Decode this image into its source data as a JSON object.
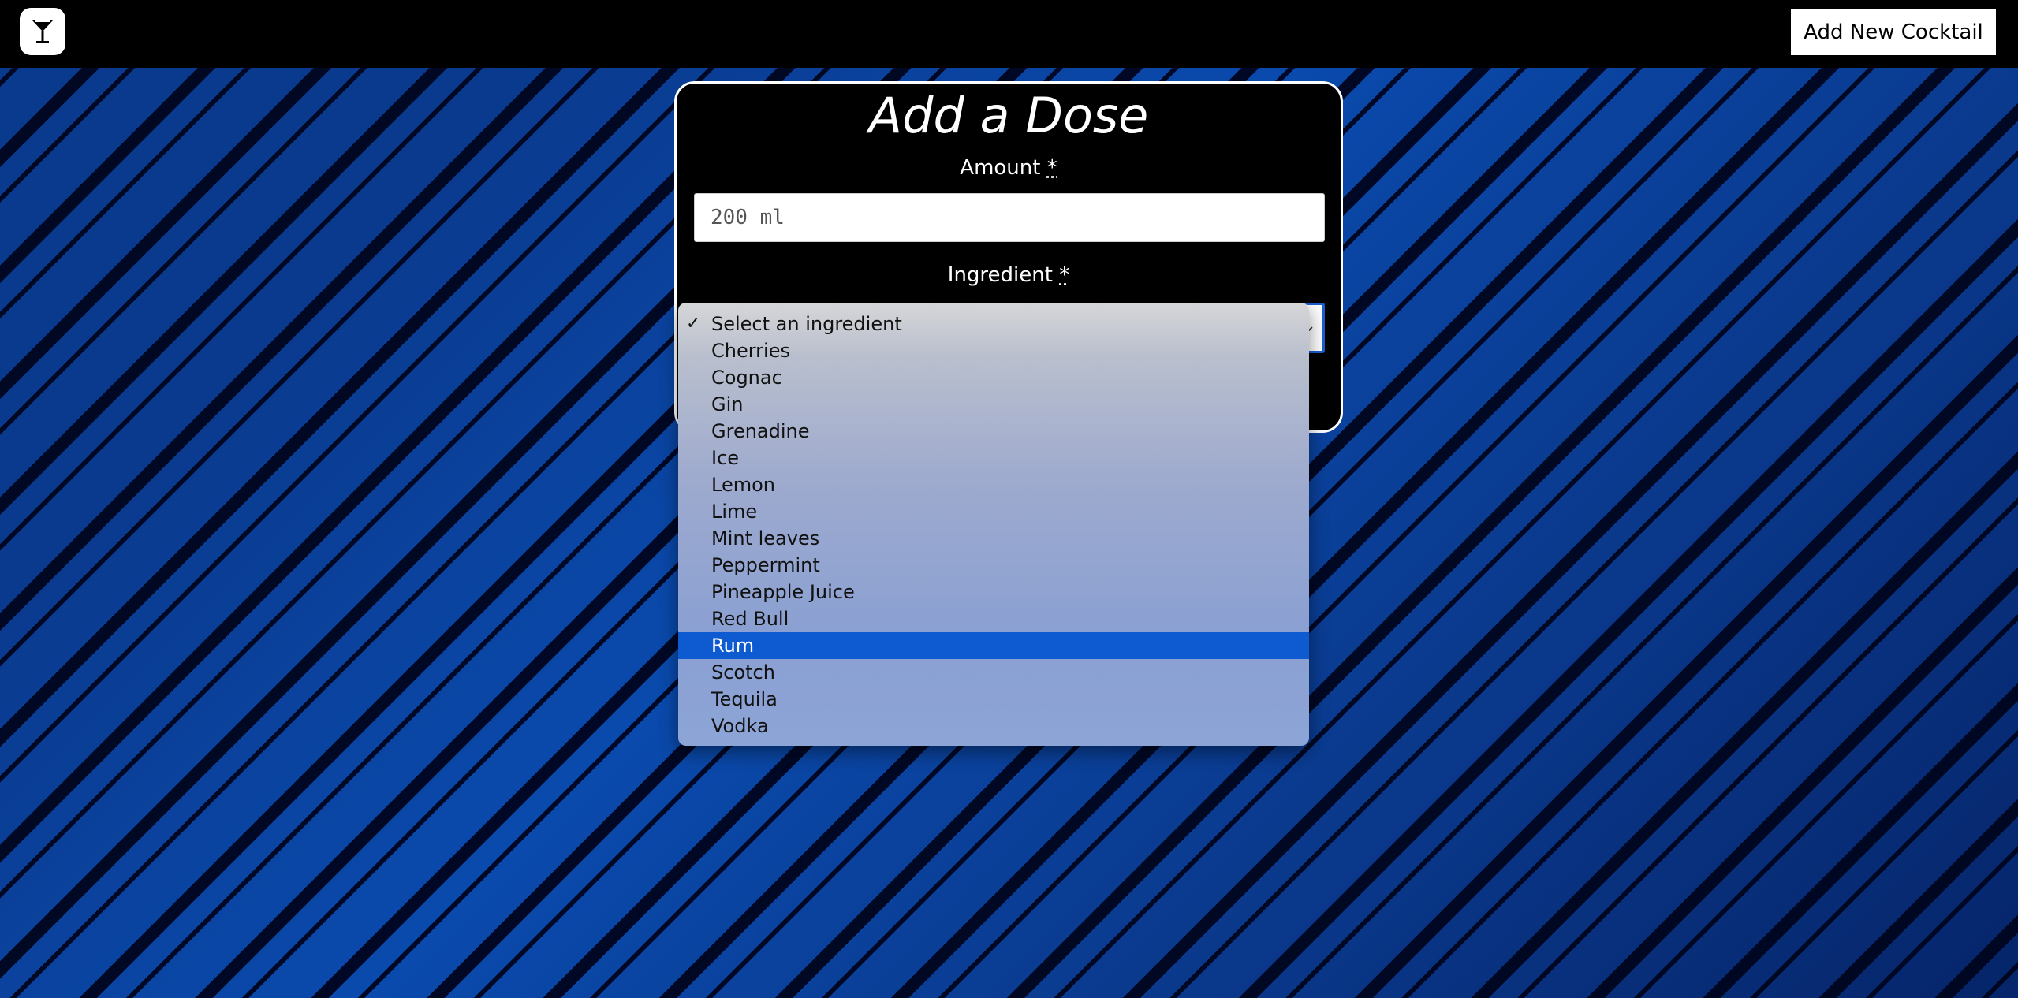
{
  "topbar": {
    "logo_icon": "cocktail-glass-icon",
    "add_button_label": "Add New Cocktail"
  },
  "form": {
    "title": "Add a Dose",
    "amount": {
      "label": "Amount",
      "required_mark": "*",
      "value": "200 ml"
    },
    "ingredient": {
      "label": "Ingredient",
      "required_mark": "*",
      "selected": "Select an ingredient",
      "options": [
        "Select an ingredient",
        "Cherries",
        "Cognac",
        "Gin",
        "Grenadine",
        "Ice",
        "Lemon",
        "Lime",
        "Mint leaves",
        "Peppermint",
        "Pineapple Juice",
        "Red Bull",
        "Rum",
        "Scotch",
        "Tequila",
        "Vodka"
      ],
      "highlighted": "Rum"
    }
  },
  "colors": {
    "accent": "#0e5bd1",
    "topbar": "#000000",
    "background": "#0a3a8e"
  }
}
